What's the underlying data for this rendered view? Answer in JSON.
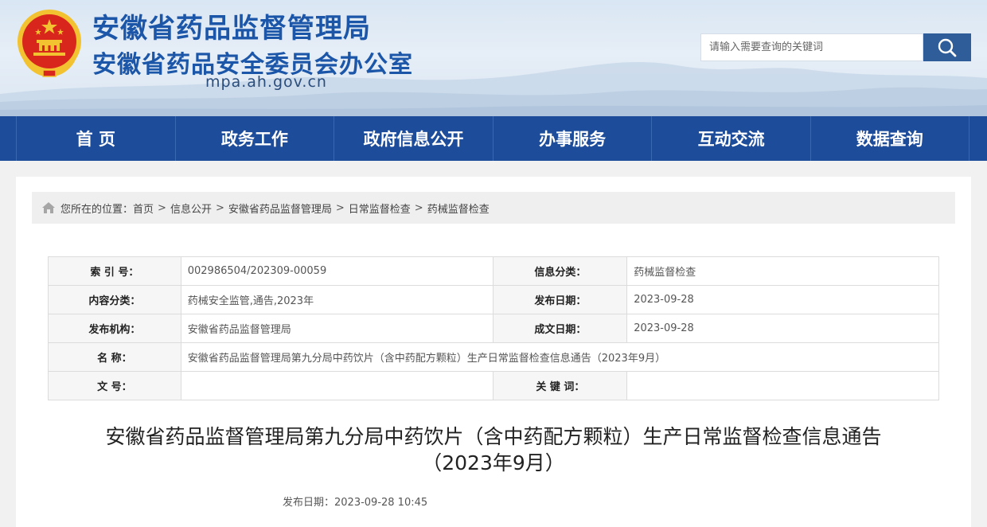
{
  "header": {
    "title_line1": "安徽省药品监督管理局",
    "title_line2": "安徽省药品安全委员会办公室",
    "domain": "mpa.ah.gov.cn",
    "search_placeholder": "请输入需要查询的关键词",
    "colors": {
      "title": "#1b56a8",
      "search_button": "#2e5d99",
      "emblem_red": "#d9261c",
      "emblem_gold": "#f2c230"
    }
  },
  "nav": {
    "items": [
      "首 页",
      "政务工作",
      "政府信息公开",
      "办事服务",
      "互动交流",
      "数据查询"
    ],
    "color": "#1d4c9b"
  },
  "breadcrumb": {
    "prefix": "您所在的位置：",
    "items": [
      "首页",
      "信息公开",
      "安徽省药品监督管理局",
      "日常监督检查",
      "药械监督检查"
    ],
    "separator": ">"
  },
  "info": {
    "rows": [
      {
        "label1": "索 引 号：",
        "value1": "002986504/202309-00059",
        "label2": "信息分类：",
        "value2": "药械监督检查"
      },
      {
        "label1": "内容分类：",
        "value1": "药械安全监管,通告,2023年",
        "label2": "发布日期：",
        "value2": "2023-09-28"
      },
      {
        "label1": "发布机构：",
        "value1": "安徽省药品监督管理局",
        "label2": "成文日期：",
        "value2": "2023-09-28"
      }
    ],
    "name_label": "名 称：",
    "name_value": "安徽省药品监督管理局第九分局中药饮片（含中药配方颗粒）生产日常监督检查信息通告（2023年9月）",
    "docno_label": "文 号：",
    "docno_value": "",
    "keywords_label": "关 键 词：",
    "keywords_value": ""
  },
  "article": {
    "title_line1": "安徽省药品监督管理局第九分局中药饮片（含中药配方颗粒）生产日常监督检查信息通告",
    "title_line2": "（2023年9月）",
    "pub_date": "发布日期：2023-09-28 10:45"
  }
}
